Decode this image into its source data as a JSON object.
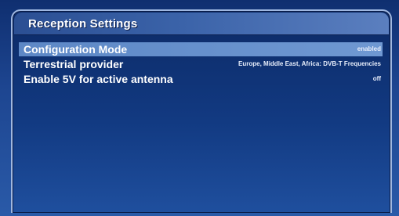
{
  "window": {
    "title": "Reception Settings"
  },
  "settings": [
    {
      "label": "Configuration Mode",
      "value": "enabled",
      "selected": true
    },
    {
      "label": "Terrestrial provider",
      "value": "Europe, Middle East, Africa: DVB-T Frequencies",
      "selected": false
    },
    {
      "label": "Enable 5V for active antenna",
      "value": "off",
      "selected": false
    }
  ],
  "colors": {
    "highlight": "#6f98d2",
    "background": "#123a82",
    "title_bar": "#3b63a9"
  }
}
